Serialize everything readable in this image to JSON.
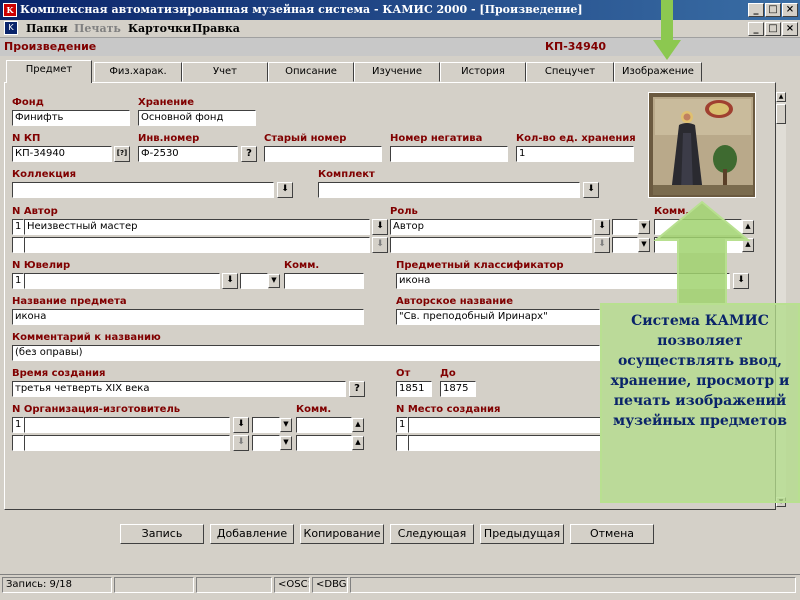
{
  "window": {
    "title": "Комплексная автоматизированная музейная система - КАМИС 2000 - [Произведение]",
    "app_icon": "КАМИС",
    "min": "_",
    "max": "□",
    "close": "×"
  },
  "menu": {
    "items": [
      "Папки",
      "Печать",
      "Карточки",
      "Правка"
    ]
  },
  "record": {
    "title": "Произведение",
    "number": "КП-34940"
  },
  "tabs": [
    "Предмет",
    "Физ.харак.",
    "Учет",
    "Описание",
    "Изучение",
    "История",
    "Спецучет",
    "Изображение"
  ],
  "form": {
    "fond_label": "Фонд",
    "fond": "Финифть",
    "storage_label": "Хранение",
    "storage": "Основной фонд",
    "nkp_label": "N  КП",
    "nkp": "КП-34940",
    "inv_label": "Инв.номер",
    "inv": "Ф-2530",
    "oldnum_label": "Старый номер",
    "oldnum": "",
    "negative_label": "Номер негатива",
    "negative": "",
    "units_label": "Кол-во ед. хранения",
    "units": "1",
    "collection_label": "Коллекция",
    "collection": "",
    "set_label": "Комплект",
    "set": "",
    "author_n_label": "N Автор",
    "author_row1_n": "1",
    "author_row1": "Неизвестный мастер",
    "author_row2_n": "",
    "author_row2": "",
    "role_label": "Роль",
    "role1": "Автор",
    "role2": "",
    "comm_label": "Комм.",
    "jeweler_label": "N Ювелир",
    "jeweler_n": "1",
    "jeweler": "",
    "jeweler_comm_label": "Комм.",
    "classifier_label": "Предметный классификатор",
    "classifier": "икона",
    "name_label": "Название предмета",
    "name": "икона",
    "author_title_label": "Авторское название",
    "author_title": "\"Св. преподобный Иринарх\"",
    "name_comment_label": "Комментарий к названию",
    "name_comment": "(без оправы)",
    "time_label": "Время создания",
    "time": "третья четверть XIX века",
    "from_label": "От",
    "from": "1851",
    "to_label": "До",
    "to": "1875",
    "org_label": "N Организация-изготовитель",
    "org_n": "1",
    "org": "",
    "org_comm_label": "Комм.",
    "place_label": "N Место создания",
    "place_n": "1",
    "place": "",
    "qmark": "?",
    "qmark_ru": "[?]"
  },
  "buttons": [
    "Запись",
    "Добавление",
    "Копирование",
    "Следующая",
    "Предыдущая",
    "Отмена"
  ],
  "status": {
    "record": "Запись: 9/18",
    "osc": "<OSC>",
    "dbg": "<DBG>"
  },
  "overlay": {
    "text": "Система КАМИС позволяет осуществлять ввод, хранение, просмотр и печать изображений музейных предметов"
  },
  "colors": {
    "accent_label": "#800000",
    "arrow": "#8cc850",
    "title_bar": "#0a246a"
  }
}
